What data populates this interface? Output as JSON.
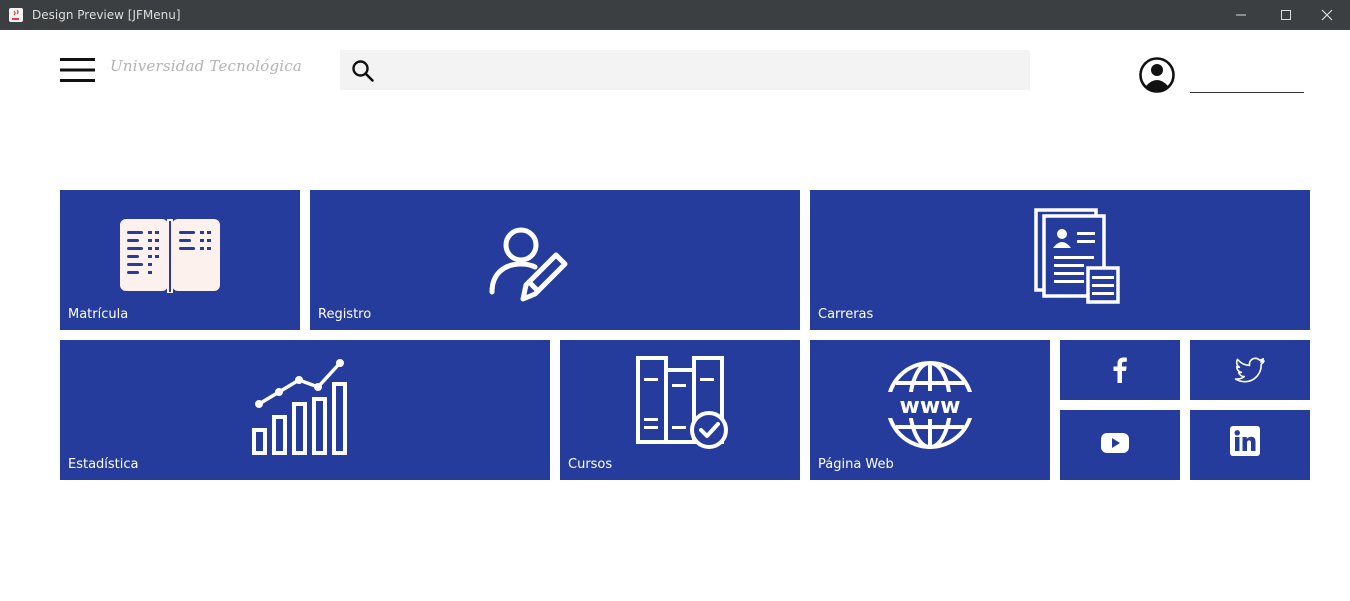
{
  "window": {
    "title": "Design Preview [JFMenu]",
    "controls": [
      "minimize",
      "maximize",
      "close"
    ]
  },
  "header": {
    "brand": "Universidad Tecnológica",
    "search": {
      "value": "",
      "placeholder": ""
    },
    "user": {
      "name": ""
    }
  },
  "tiles": {
    "matricula": {
      "label": "Matrícula",
      "icon": "open-book-icon"
    },
    "registro": {
      "label": "Registro",
      "icon": "user-edit-icon"
    },
    "carreras": {
      "label": "Carreras",
      "icon": "resume-documents-icon"
    },
    "estadistica": {
      "label": "Estadística",
      "icon": "bar-chart-trend-icon"
    },
    "cursos": {
      "label": "Cursos",
      "icon": "books-check-icon"
    },
    "pagina_web": {
      "label": "Página Web",
      "icon": "www-globe-icon"
    },
    "facebook": {
      "icon": "facebook-icon"
    },
    "twitter": {
      "icon": "twitter-icon"
    },
    "youtube": {
      "icon": "youtube-icon"
    },
    "linkedin": {
      "icon": "linkedin-icon"
    }
  },
  "colors": {
    "tile": "#253c9c",
    "titlebar": "#3c3f41",
    "search_bg": "#f3f3f3",
    "book_pages": "#fdf1ee"
  }
}
